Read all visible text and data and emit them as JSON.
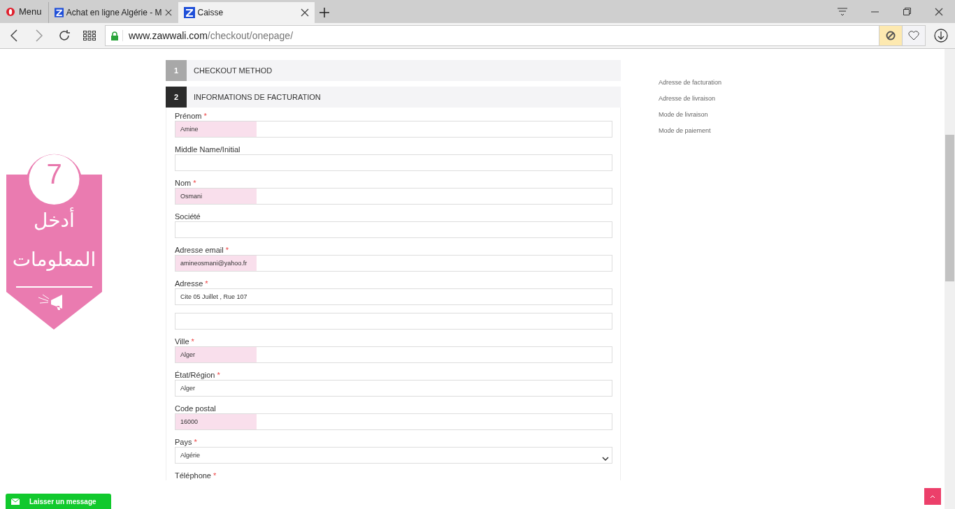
{
  "browser": {
    "menu_label": "Menu",
    "tabs": [
      {
        "title": "Achat en ligne Algérie - M",
        "selected": false
      },
      {
        "title": "Caisse",
        "selected": true
      }
    ],
    "address": {
      "domain": "www.zawwali.com",
      "path": "/checkout/onepage/"
    }
  },
  "steps": [
    {
      "number": "1",
      "title": "CHECKOUT METHOD",
      "active": false
    },
    {
      "number": "2",
      "title": "INFORMATIONS DE FACTURATION",
      "active": true
    }
  ],
  "fields": [
    {
      "kind": "text",
      "label": "Prénom",
      "required_mark": "*",
      "value": "Amine",
      "highlighted": true
    },
    {
      "kind": "text",
      "label": "Middle Name/Initial",
      "highlighted": false
    },
    {
      "kind": "text",
      "label": "Nom",
      "required_mark": "*",
      "value": "Osmani",
      "highlighted": true
    },
    {
      "kind": "text",
      "label": "Société",
      "highlighted": false
    },
    {
      "kind": "text",
      "label": "Adresse email",
      "required_mark": "*",
      "value": "amineosmani@yahoo.fr",
      "highlighted": true
    },
    {
      "kind": "text",
      "label": "Adresse",
      "required_mark": "*",
      "value": "Cite 05 Juillet , Rue 107",
      "highlighted": false
    },
    {
      "kind": "text",
      "highlighted": false
    },
    {
      "kind": "text",
      "label": "Ville",
      "required_mark": "*",
      "value": "Alger",
      "highlighted": true
    },
    {
      "kind": "text",
      "label": "État/Région",
      "required_mark": "*",
      "value": "Alger",
      "highlighted": false
    },
    {
      "kind": "text",
      "label": "Code postal",
      "value": "16000",
      "highlighted": true
    },
    {
      "kind": "select",
      "label": "Pays",
      "required_mark": "*",
      "value": "Algérie",
      "highlighted": false
    },
    {
      "kind": "label",
      "label": "Téléphone",
      "required_mark": "*"
    }
  ],
  "progress": [
    "Adresse de facturation",
    "Adresse de livraison",
    "Mode de livraison",
    "Mode de paiement"
  ],
  "banner": {
    "number": "7",
    "lines": [
      "أدخل",
      "المعلومات"
    ]
  },
  "chat_button": "Laisser un message"
}
